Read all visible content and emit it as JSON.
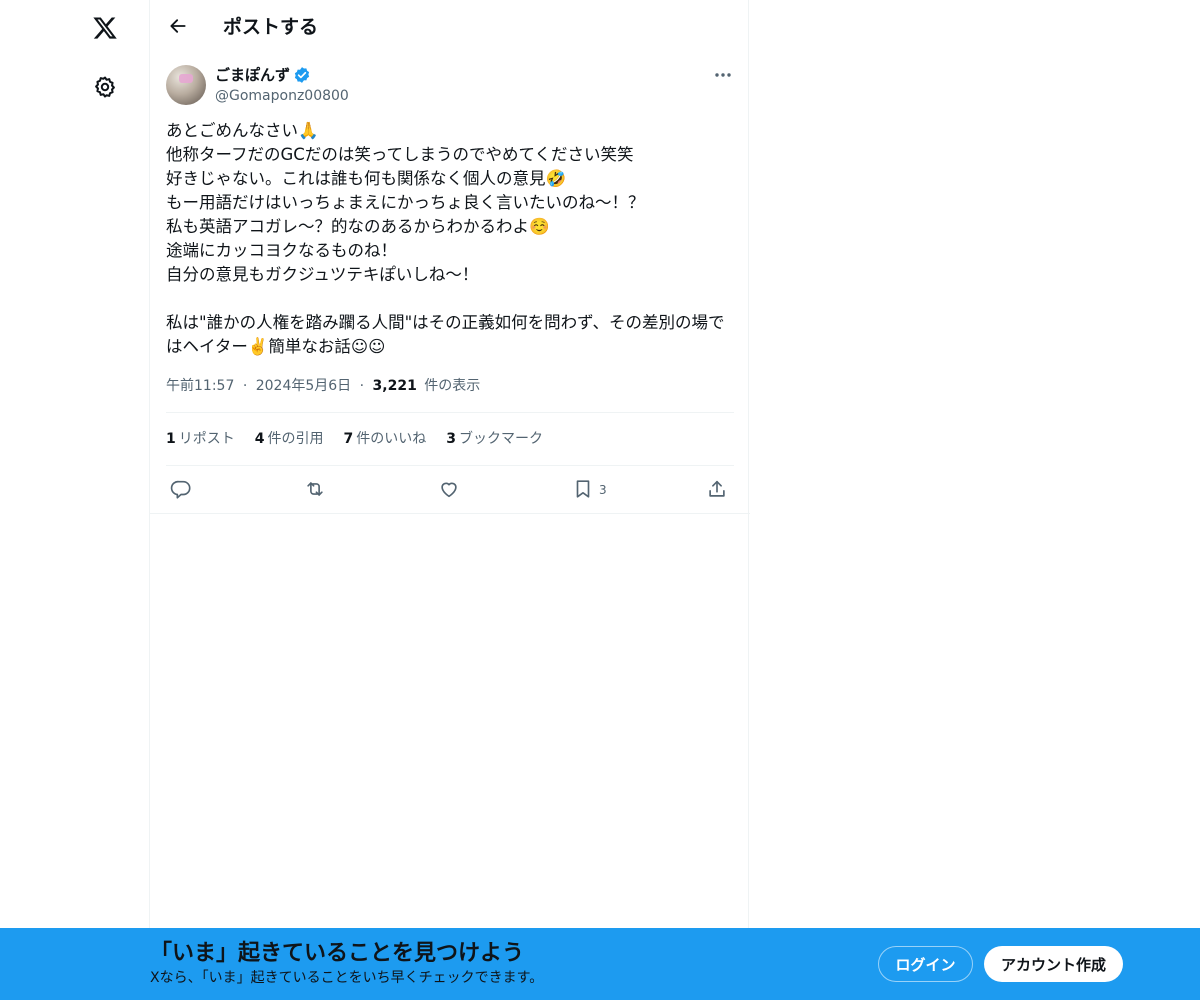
{
  "header": {
    "title": "ポストする"
  },
  "nav": {
    "logo_icon": "x-logo-icon",
    "settings_icon": "gear-icon"
  },
  "tweet": {
    "display_name": "ごまぽんず",
    "handle": "@Gomaponz00800",
    "verified": true,
    "text": "あとごめんなさい🙏\n他称ターフだのGCだのは笑ってしまうのでやめてください笑笑\n好きじゃない。これは誰も何も関係なく個人の意見🤣\nもー用語だけはいっちょまえにかっちょ良く言いたいのね〜！？\n私も英語アコガレ〜？的なのあるからわかるわよ☺️\n途端にカッコヨクなるものね！\n自分の意見もガクジュツテキぽいしね〜！\n\n私は\"誰かの人権を踏み躙る人間\"はその正義如何を問わず、その差別の場ではヘイター✌️簡単なお話☺︎☺︎",
    "time": "午前11:57",
    "date": "2024年5月6日",
    "views_count": "3,221",
    "views_label": "件の表示",
    "separator": "·"
  },
  "stats": [
    {
      "count": "1",
      "label": "リポスト"
    },
    {
      "count": "4",
      "label": "件の引用"
    },
    {
      "count": "7",
      "label": "件のいいね"
    },
    {
      "count": "3",
      "label": "ブックマーク"
    }
  ],
  "actions": {
    "bookmark_count": "3"
  },
  "bottom_bar": {
    "title": "「いま」起きていることを見つけよう",
    "subtitle": "Xなら、「いま」起きていることをいち早くチェックできます。",
    "login_label": "ログイン",
    "signup_label": "アカウント作成",
    "bg_color": "#1d9bf0"
  }
}
